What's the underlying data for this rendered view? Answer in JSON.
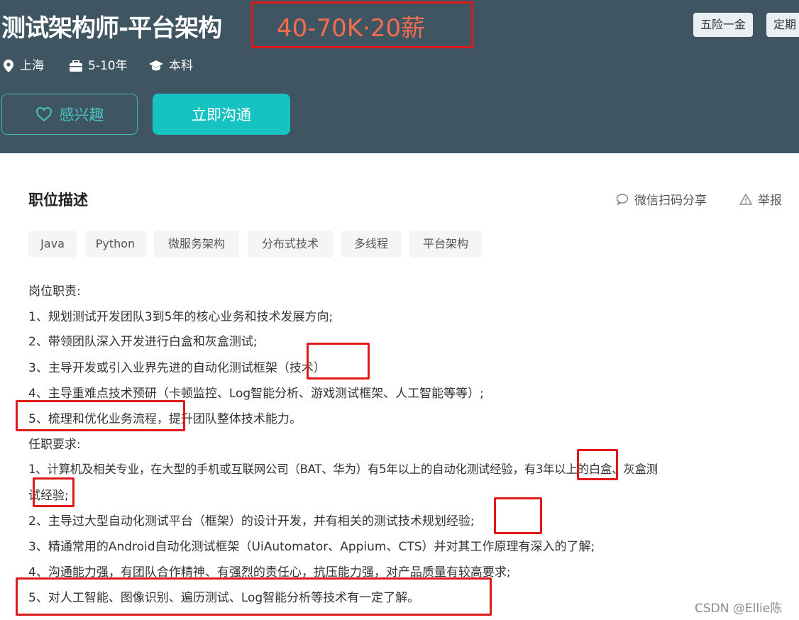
{
  "header": {
    "job_title": "测试架构师-平台架构",
    "salary": "40-70K·20薪",
    "benefits": [
      "五险一金",
      "定期"
    ],
    "meta": {
      "location": "上海",
      "experience": "5-10年",
      "education": "本科"
    },
    "buttons": {
      "interest": "感兴趣",
      "chat": "立即沟通"
    }
  },
  "description": {
    "section_title": "职位描述",
    "actions": {
      "share": "微信扫码分享",
      "report": "举报"
    },
    "tags": [
      "Java",
      "Python",
      "微服务架构",
      "分布式技术",
      "多线程",
      "平台架构"
    ],
    "lines": [
      "岗位职责:",
      "1、规划测试开发团队3到5年的核心业务和技术发展方向;",
      "2、带领团队深入开发进行白盒和灰盒测试;",
      "3、主导开发或引入业界先进的自动化测试框架（技术）",
      "4、主导重难点技术预研（卡顿监控、Log智能分析、游戏测试框架、人工智能等等）;",
      "5、梳理和优化业务流程，提升团队整体技术能力。",
      "任职要求:",
      "1、计算机及相关专业，在大型的手机或互联网公司（BAT、华为）有5年以上的自动化测试经验，有3年以上的白盒、灰盒测",
      "试经验;",
      "2、主导过大型自动化测试平台（框架）的设计开发，并有相关的测试技术规划经验;",
      "3、精通常用的Android自动化测试框架（UiAutomator、Appium、CTS）并对其工作原理有深入的了解;",
      "4、沟通能力强，有团队合作精神、有强烈的责任心，抗压能力强，对产品质量有较高要求;",
      "5、对人工智能、图像识别、遍历测试、Log智能分析等技术有一定了解。"
    ]
  },
  "watermark": "CSDN @Ellie陈",
  "colors": {
    "header_bg": "#3f5562",
    "salary": "#f26d4f",
    "accent": "#16c2c2",
    "highlight_box": "#e01a1a"
  }
}
